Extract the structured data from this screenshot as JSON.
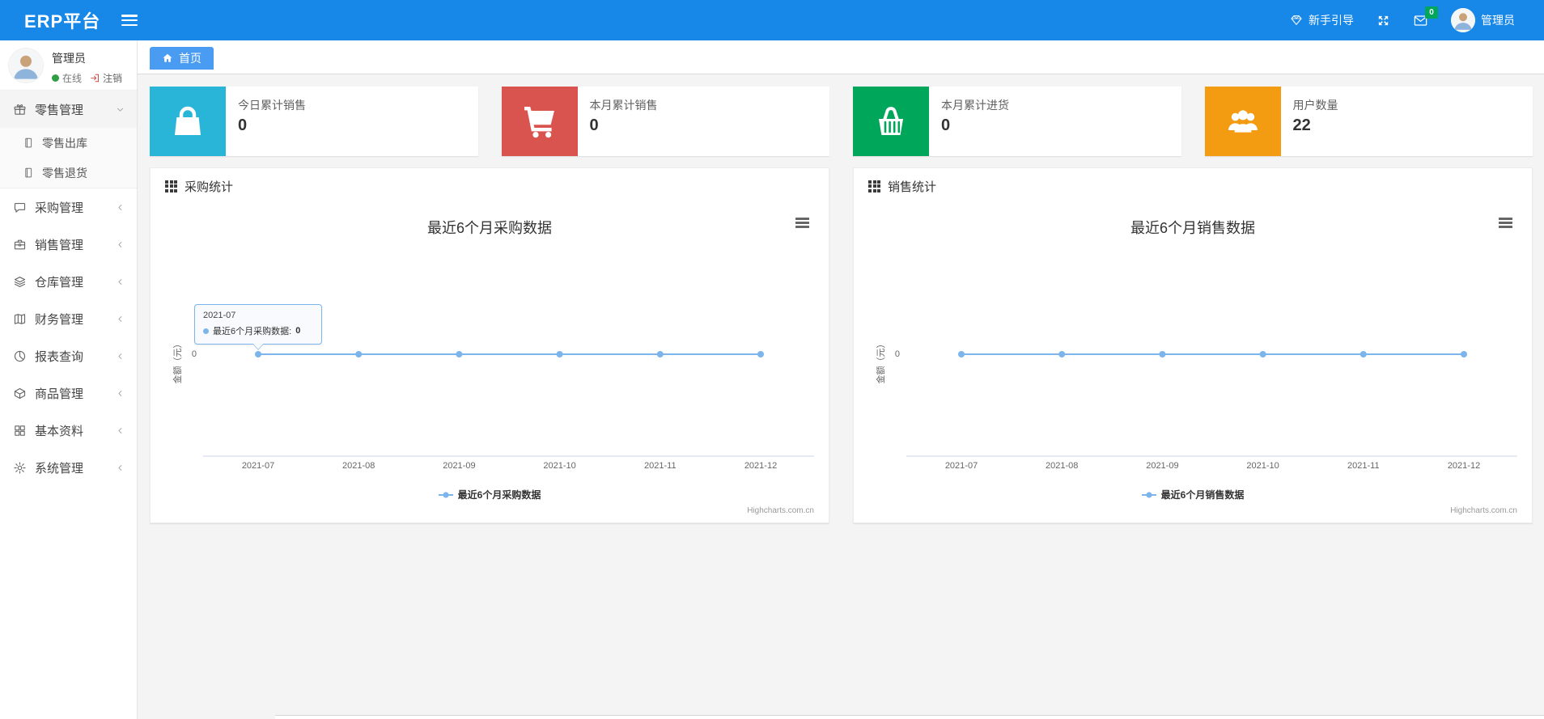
{
  "navbar": {
    "brand": "ERP平台",
    "guide_label": "新手引导",
    "mail_badge": "0",
    "username": "管理员"
  },
  "sidebar": {
    "user": {
      "name": "管理员",
      "status": "在线",
      "logout": "注销"
    },
    "menu": [
      {
        "id": "retail-management",
        "label": "零售管理",
        "icon": "gift-icon",
        "state": "expanded",
        "children": [
          {
            "id": "retail-outbound",
            "label": "零售出库",
            "icon": "file-icon"
          },
          {
            "id": "retail-return",
            "label": "零售退货",
            "icon": "file-icon"
          }
        ]
      },
      {
        "id": "purchase-management",
        "label": "采购管理",
        "icon": "comment-icon",
        "state": "collapsed"
      },
      {
        "id": "sales-management",
        "label": "销售管理",
        "icon": "briefcase-icon",
        "state": "collapsed"
      },
      {
        "id": "warehouse-management",
        "label": "仓库管理",
        "icon": "layers-icon",
        "state": "collapsed"
      },
      {
        "id": "finance-management",
        "label": "财务管理",
        "icon": "book-icon",
        "state": "collapsed"
      },
      {
        "id": "report-query",
        "label": "报表查询",
        "icon": "pie-chart-icon",
        "state": "collapsed"
      },
      {
        "id": "goods-management",
        "label": "商品管理",
        "icon": "cube-icon",
        "state": "collapsed"
      },
      {
        "id": "basic-data",
        "label": "基本资料",
        "icon": "grid-icon",
        "state": "collapsed"
      },
      {
        "id": "system-management",
        "label": "系统管理",
        "icon": "gear-icon",
        "state": "collapsed"
      }
    ]
  },
  "tabs": [
    {
      "label": "首页",
      "icon": "home-icon",
      "active": true
    }
  ],
  "stat_cards": [
    {
      "id": "today-sales",
      "label": "今日累计销售",
      "value": "0",
      "color": "#29b5d8",
      "icon": "shopping-bag-icon"
    },
    {
      "id": "month-sales",
      "label": "本月累计销售",
      "value": "0",
      "color": "#d9534f",
      "icon": "shopping-cart-icon"
    },
    {
      "id": "month-purchase",
      "label": "本月累计进货",
      "value": "0",
      "color": "#00a65a",
      "icon": "basket-icon"
    },
    {
      "id": "user-count",
      "label": "用户数量",
      "value": "22",
      "color": "#f39c12",
      "icon": "users-icon"
    }
  ],
  "panels": [
    {
      "id": "purchase-stats",
      "title": "采购统计"
    },
    {
      "id": "sales-stats",
      "title": "销售统计"
    }
  ],
  "chart_data": [
    {
      "type": "line",
      "title": "最近6个月采购数据",
      "categories": [
        "2021-07",
        "2021-08",
        "2021-09",
        "2021-10",
        "2021-11",
        "2021-12"
      ],
      "series": [
        {
          "name": "最近6个月采购数据",
          "values": [
            0,
            0,
            0,
            0,
            0,
            0
          ]
        }
      ],
      "xlabel": "",
      "ylabel": "金额（元）",
      "yticks": [
        "0"
      ],
      "grid": false,
      "legend_position": "bottom",
      "credits": "Highcharts.com.cn",
      "tooltip": {
        "visible": true,
        "category": "2021-07",
        "series_label": "最近6个月采购数据: ",
        "value": "0",
        "point_index": 0
      }
    },
    {
      "type": "line",
      "title": "最近6个月销售数据",
      "categories": [
        "2021-07",
        "2021-08",
        "2021-09",
        "2021-10",
        "2021-11",
        "2021-12"
      ],
      "series": [
        {
          "name": "最近6个月销售数据",
          "values": [
            0,
            0,
            0,
            0,
            0,
            0
          ]
        }
      ],
      "xlabel": "",
      "ylabel": "金额（元）",
      "yticks": [
        "0"
      ],
      "grid": false,
      "legend_position": "bottom",
      "credits": "Highcharts.com.cn",
      "tooltip": {
        "visible": false
      }
    }
  ],
  "colors": {
    "navbar": "#1787e8",
    "tab_active": "#4a9cf2",
    "series_line": "#7cb5ec",
    "axis_line": "#ccd6eb",
    "badge_green": "#00a65a",
    "online_dot": "#2f9e44",
    "logout_red": "#c9302c"
  }
}
